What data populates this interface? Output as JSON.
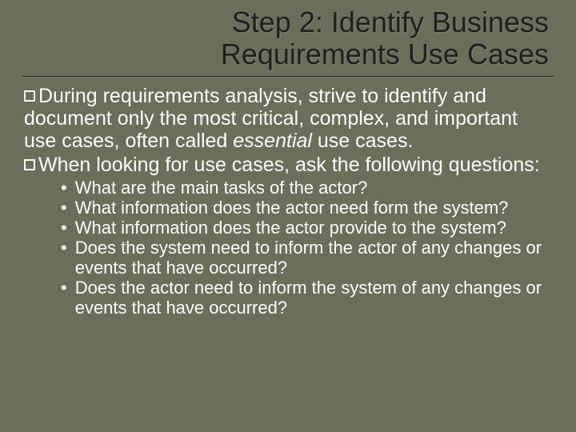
{
  "title_line1": "Step 2: Identify Business",
  "title_line2": "Requirements Use Cases",
  "p1_a": "During requirements analysis, strive to identify and document only the most critical, complex, and important use cases, often called ",
  "p1_b": "essential",
  "p1_c": " use cases.",
  "p2": "When looking for use cases, ask the following questions:",
  "sub": [
    "What are the main tasks of the actor?",
    "What information does the actor need form the system?",
    "What information does the actor provide to the system?",
    "Does the system need to inform the actor of any changes or events that have occurred?",
    "Does the actor need to inform the system of any changes or events that have occurred?"
  ]
}
